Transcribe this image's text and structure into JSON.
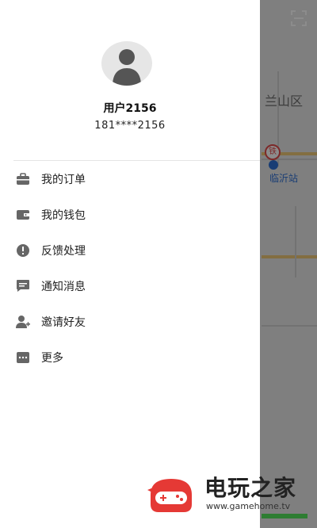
{
  "map": {
    "district": "兰山区",
    "station": "临沂站",
    "metro_badge": "铁"
  },
  "user": {
    "name": "用户2156",
    "phone": "181****2156"
  },
  "menu": [
    {
      "label": "我的订单",
      "icon": "briefcase-icon"
    },
    {
      "label": "我的钱包",
      "icon": "wallet-icon"
    },
    {
      "label": "反馈处理",
      "icon": "alert-circle-icon"
    },
    {
      "label": "通知消息",
      "icon": "message-icon"
    },
    {
      "label": "邀请好友",
      "icon": "add-user-icon"
    },
    {
      "label": "更多",
      "icon": "more-icon"
    }
  ],
  "watermark": {
    "brand": "电玩之家",
    "url": "www.gamehome.tv"
  },
  "colors": {
    "icon_gray": "#666666",
    "overlay": "rgba(0,0,0,0.45)",
    "watermark_red": "#e53935"
  }
}
